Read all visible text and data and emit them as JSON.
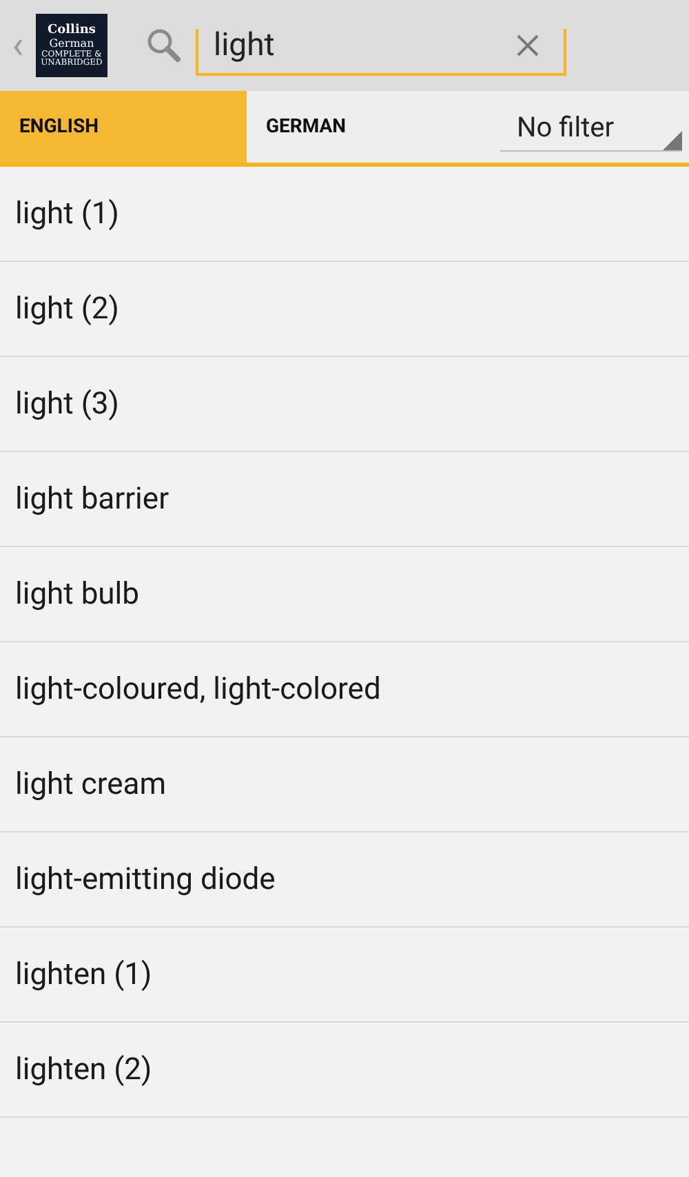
{
  "header": {
    "back": "‹",
    "logo": {
      "title": "Collins",
      "subtitle": "German",
      "tagline": "COMPLETE & UNABRIDGED"
    },
    "search": {
      "value": "light"
    }
  },
  "tabs": [
    {
      "label": "ENGLISH",
      "selected": true
    },
    {
      "label": "GERMAN",
      "selected": false
    }
  ],
  "filter": {
    "value": "No filter"
  },
  "results": [
    "light (1)",
    "light (2)",
    "light (3)",
    "light barrier",
    "light bulb",
    "light-coloured, light-colored",
    "light cream",
    "light-emitting diode",
    "lighten (1)",
    "lighten (2)"
  ]
}
